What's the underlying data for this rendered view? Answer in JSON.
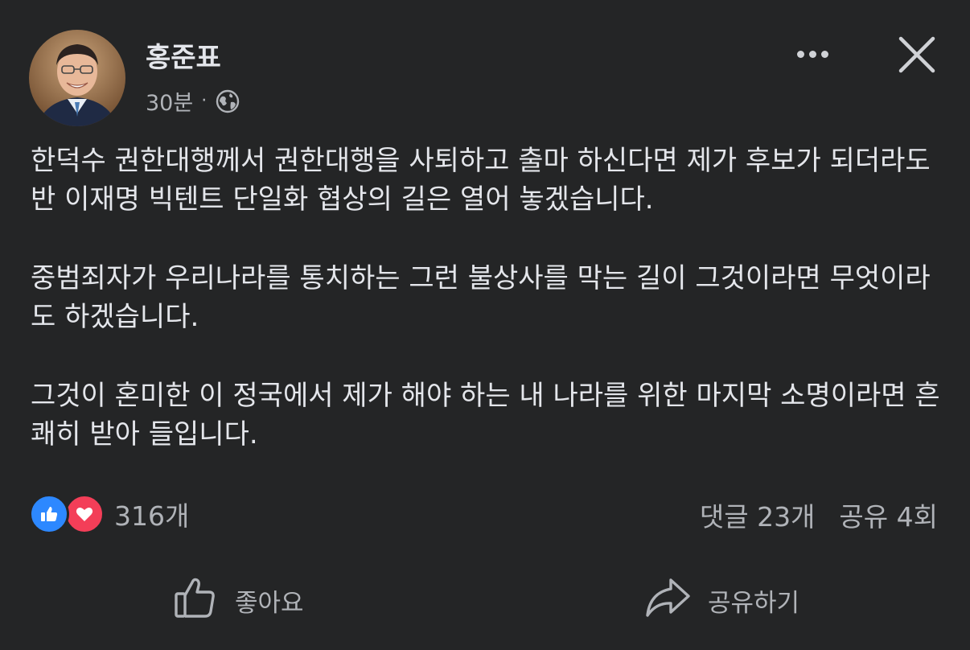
{
  "post": {
    "author": "홍준표",
    "time": "30분",
    "separator": "·",
    "privacy_icon": "globe-icon",
    "body": [
      "한덕수 권한대행께서 권한대행을 사퇴하고 출마 하신다면 제가 후보가 되더라도 반 이재명 빅텐트 단일화 협상의 길은 열어 놓겠습니다.",
      "중범죄자가 우리나라를 통치하는 그런 불상사를 막는 길이 그것이라면 무엇이라도 하겠습니다.",
      "그것이 혼미한 이 정국에서 제가 해야 하는 내 나라를 위한 마지막 소명이라면 흔쾌히 받아 들입니다."
    ]
  },
  "header": {
    "more_icon": "more-horizontal-icon",
    "close_icon": "close-icon"
  },
  "engagement": {
    "reaction_icons": [
      "like-reaction-icon",
      "love-reaction-icon"
    ],
    "reaction_count": "316개",
    "comments": "댓글 23개",
    "shares": "공유 4회"
  },
  "actions": {
    "like_label": "좋아요",
    "share_label": "공유하기"
  },
  "colors": {
    "background": "#242526",
    "text_primary": "#e4e6eb",
    "text_secondary": "#b0b3b8",
    "like_blue": "#2d88ff",
    "love_red": "#f33e58"
  }
}
